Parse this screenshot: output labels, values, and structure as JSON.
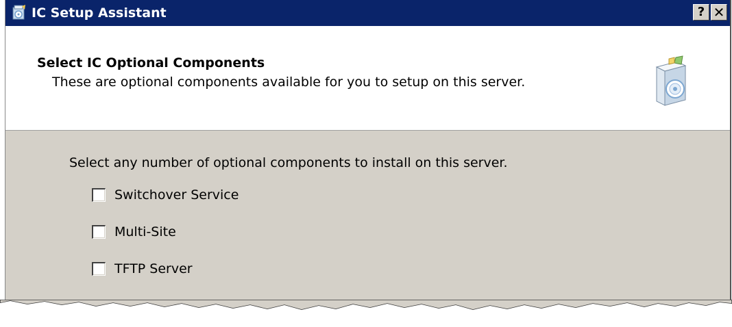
{
  "window": {
    "title": "IC Setup Assistant",
    "help_label": "?",
    "close_label": "✕"
  },
  "header": {
    "title": "Select IC Optional Components",
    "subtitle": "These are optional components available for you to setup on this server."
  },
  "body": {
    "instruction": "Select any number of optional components to install on this server.",
    "options": [
      {
        "label": "Switchover Service",
        "checked": false
      },
      {
        "label": "Multi-Site",
        "checked": false
      },
      {
        "label": "TFTP Server",
        "checked": false
      }
    ]
  },
  "icons": {
    "title_icon": "setup-assistant-icon",
    "header_icon": "software-box-cd-icon"
  },
  "colors": {
    "titlebar": "#0a246a",
    "dialog_face": "#d4d0c8",
    "header_background": "#ffffff"
  }
}
